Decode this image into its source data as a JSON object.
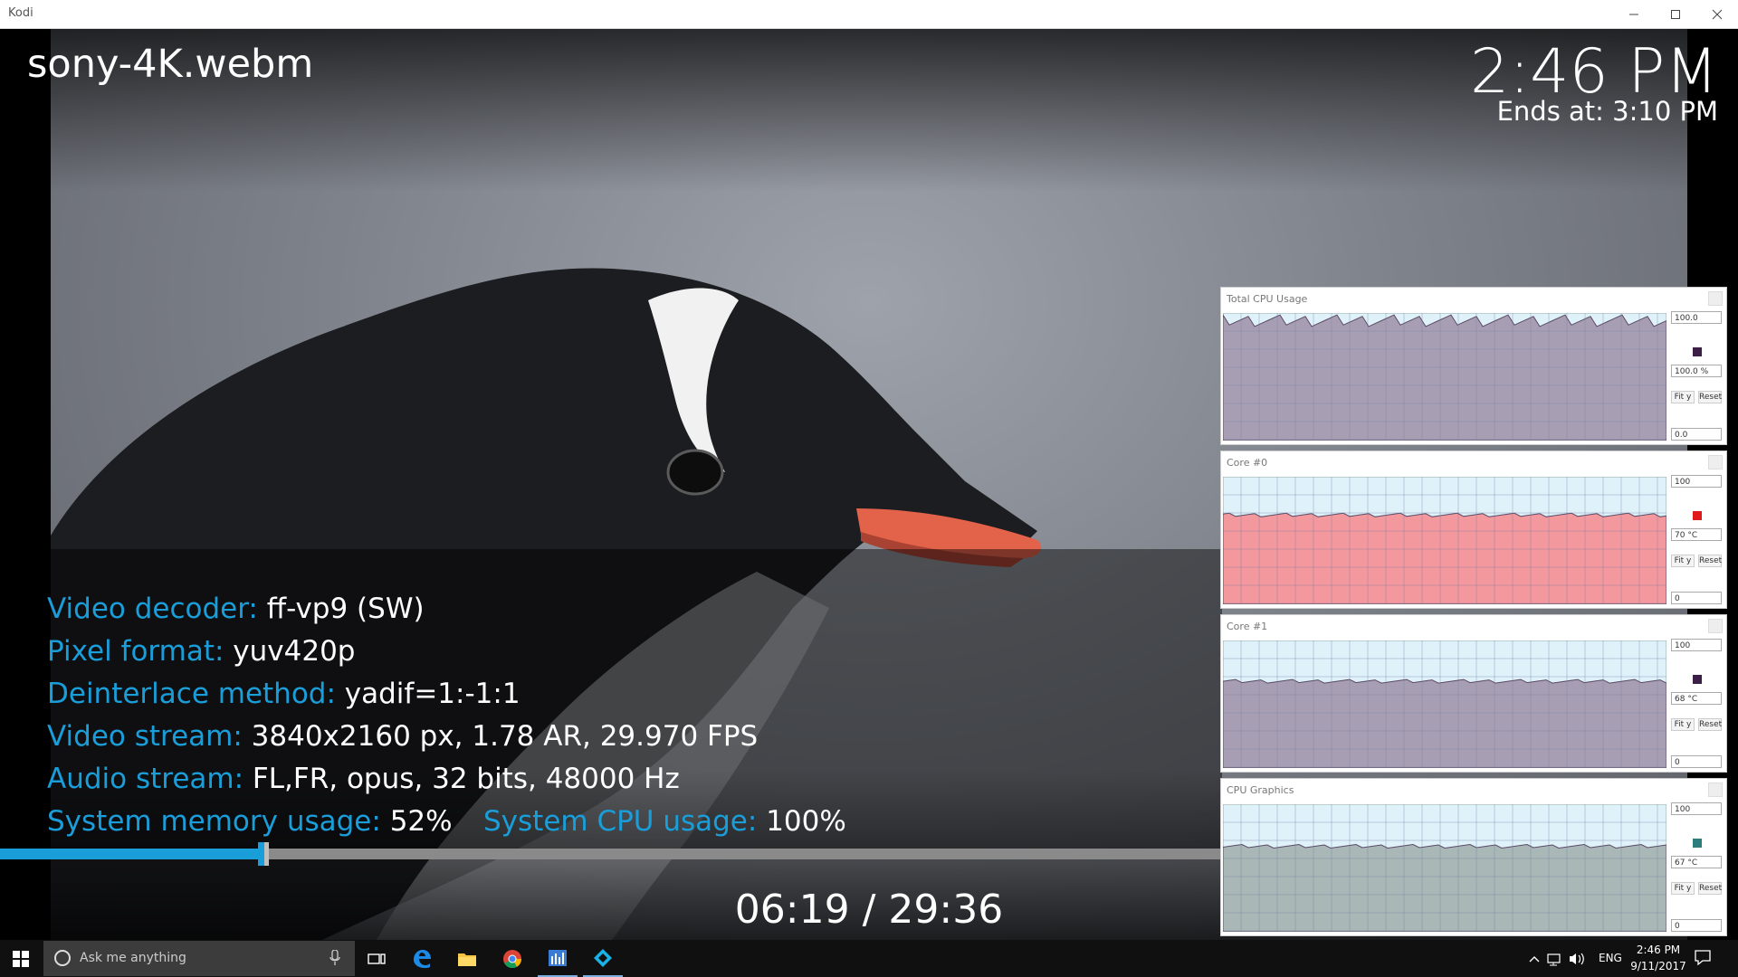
{
  "window": {
    "title": "Kodi"
  },
  "player": {
    "file_title": "sony-4K.webm",
    "clock": "2:46 PM",
    "ends_at": "Ends at: 3:10 PM",
    "time_readout": "06:19 / 29:36",
    "progress": 0.214
  },
  "codec_info": {
    "lines": [
      {
        "key": "Video decoder:",
        "value": "ff-vp9 (SW)"
      },
      {
        "key": "Pixel format:",
        "value": "yuv420p"
      },
      {
        "key": "Deinterlace method:",
        "value": "yadif=1:-1:1"
      },
      {
        "key": "Video stream:",
        "value": "3840x2160 px, 1.78 AR, 29.970 FPS"
      },
      {
        "key": "Audio stream:",
        "value": "FL,FR, opus, 32 bits, 48000 Hz"
      },
      {
        "key": "System memory usage:",
        "value": "52%"
      }
    ],
    "cpu": {
      "key": "System CPU usage:",
      "value": "100%"
    }
  },
  "monitors": [
    {
      "title": "Total CPU Usage",
      "max": "100.0",
      "value": "100.0 %",
      "min": "0.0",
      "fit_label": "Fit y",
      "reset_label": "Reset",
      "swatch": "#3b1f47",
      "fill": "#a89eb3",
      "bg": "#dff2fa",
      "level": 0.94
    },
    {
      "title": "Core #0",
      "max": "100",
      "value": "70 °C",
      "min": "0",
      "fit_label": "Fit y",
      "reset_label": "Reset",
      "swatch": "#e01a1a",
      "fill": "#f3999d",
      "bg": "#dff2fa",
      "level": 0.7
    },
    {
      "title": "Core #1",
      "max": "100",
      "value": "68 °C",
      "min": "0",
      "fit_label": "Fit y",
      "reset_label": "Reset",
      "swatch": "#3b1f47",
      "fill": "#a89eb3",
      "bg": "#dff2fa",
      "level": 0.68
    },
    {
      "title": "CPU Graphics",
      "max": "100",
      "value": "67 °C",
      "min": "0",
      "fit_label": "Fit y",
      "reset_label": "Reset",
      "swatch": "#2e7d7d",
      "fill": "#a9b8b6",
      "bg": "#dff2fa",
      "level": 0.67
    }
  ],
  "taskbar": {
    "search_placeholder": "Ask me anything",
    "apps": [
      "task-view",
      "edge",
      "file-explorer",
      "chrome",
      "resource-monitor",
      "kodi"
    ],
    "language": "ENG",
    "time": "2:46 PM",
    "date": "9/11/2017"
  },
  "colors": {
    "accent": "#1a9ed9",
    "taskbar": "#101010"
  }
}
